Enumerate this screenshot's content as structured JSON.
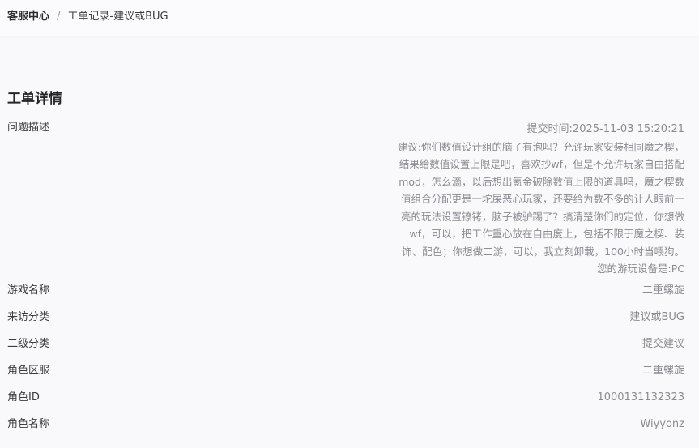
{
  "breadcrumb": {
    "root": "客服中心",
    "separator": "/",
    "current": "工单记录-建议或BUG"
  },
  "section_title": "工单详情",
  "problem": {
    "label": "问题描述",
    "submit_time": "提交时间:2025-11-03 15:20:21",
    "lines": [
      "建议:你们数值设计组的脑子有泡吗？允许玩家安装相同魔之楔，",
      "结果给数值设置上限是吧，喜欢抄wf，但是不允许玩家自由搭配",
      "mod，怎么滴，以后想出氪金破除数值上限的道具吗，魔之楔数",
      "值组合分配更是一坨屎恶心玩家，还要给为数不多的让人眼前一",
      "亮的玩法设置镣铐，脑子被驴踢了？搞清楚你们的定位，你想做",
      "wf，可以，把工作重心放在自由度上，包括不限于魔之楔、装",
      "饰、配色；你想做二游，可以，我立刻卸载，100小时当喂狗。"
    ],
    "device": "您的游玩设备是:PC"
  },
  "fields": [
    {
      "label": "游戏名称",
      "value": "二重螺旋"
    },
    {
      "label": "来访分类",
      "value": "建议或BUG"
    },
    {
      "label": "二级分类",
      "value": "提交建议"
    },
    {
      "label": "角色区服",
      "value": "二重螺旋"
    },
    {
      "label": "角色ID",
      "value": "1000131132323"
    },
    {
      "label": "角色名称",
      "value": "Wiyyonz"
    }
  ]
}
